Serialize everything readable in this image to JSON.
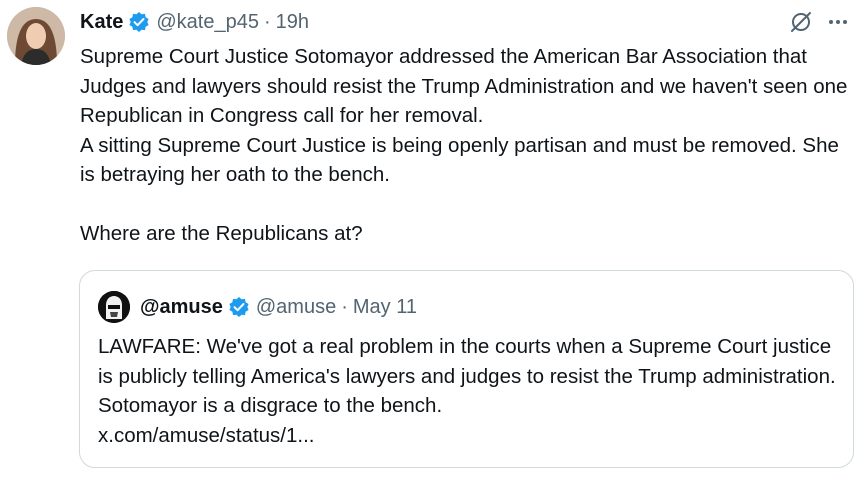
{
  "tweet": {
    "author_name": "Kate",
    "author_handle": "@kate_p45",
    "separator": "·",
    "time": "19h",
    "text": "Supreme Court Justice Sotomayor addressed the American Bar Association that Judges and lawyers should resist the Trump Administration and we haven't seen one Republican in Congress call for her removal.\nA sitting Supreme Court Justice is being openly partisan and must be removed. She is betraying her oath to the bench.\n\nWhere are the Republicans at?"
  },
  "icons": {
    "verified": "verified-badge-icon",
    "grok": "grok-icon",
    "more": "more-options-icon"
  },
  "quote": {
    "author_name": "@amuse",
    "author_handle": "@amuse",
    "separator": "·",
    "date": "May 11",
    "text": "LAWFARE: We've got a real problem in the courts when a Supreme Court justice is publicly telling America's lawyers and judges to resist the Trump administration. Sotomayor is a disgrace to the bench.",
    "link": "x.com/amuse/status/1..."
  },
  "colors": {
    "verified": "#1d9bf0",
    "secondary_text": "#536471",
    "border": "#cfd9de"
  }
}
